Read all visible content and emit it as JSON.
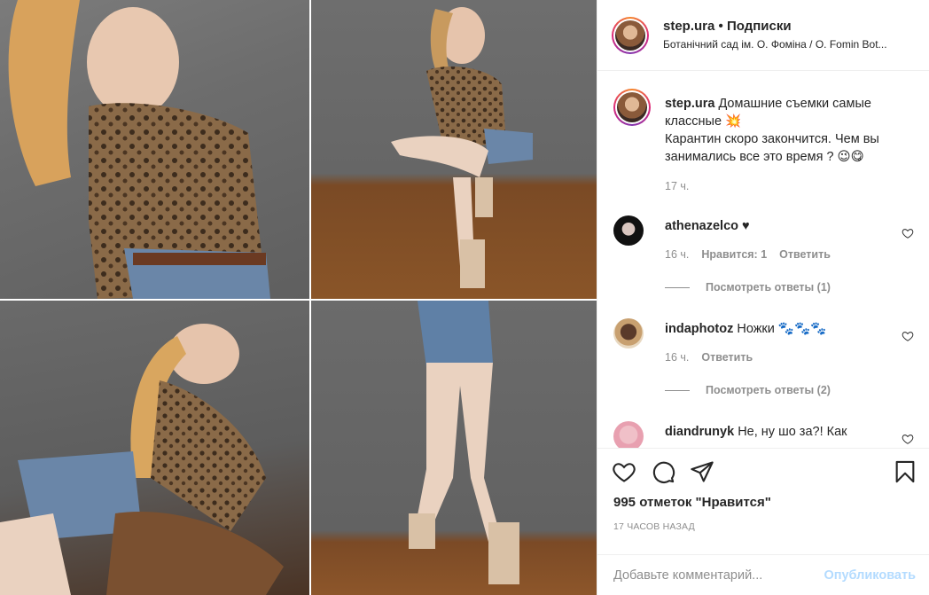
{
  "post": {
    "images": [
      "photo-collage"
    ]
  },
  "header": {
    "username": "step.ura",
    "separator": "•",
    "follow": "Подписки",
    "location": "Ботанічний сад ім. О. Фоміна / O. Fomin Bot..."
  },
  "caption": {
    "username": "step.ura",
    "text_line1": "Домашние съемки самые классные 💥",
    "text_line2": "Карантин скоро закончится. Чем вы занимались все это время ? 😉😋",
    "time": "17 ч."
  },
  "comments": [
    {
      "username": "athenazelco",
      "text": "♥",
      "time": "16 ч.",
      "likes": "Нравится: 1",
      "reply": "Ответить",
      "view_replies": "Посмотреть ответы (1)"
    },
    {
      "username": "indaphotoz",
      "text": "Ножки 🐾🐾🐾",
      "time": "16 ч.",
      "reply": "Ответить",
      "view_replies": "Посмотреть ответы (2)"
    },
    {
      "username": "diandrunyk",
      "text": "Не, ну шо за?! Как"
    }
  ],
  "actions": {
    "likes": "995 отметок \"Нравится\"",
    "time": "17 ЧАСОВ НАЗАД"
  },
  "add_comment": {
    "placeholder": "Добавьте комментарий...",
    "post_label": "Опубликовать"
  },
  "colors": {
    "text": "#262626",
    "muted": "#8e8e8e",
    "link_disabled": "#b3dbff",
    "border": "#efefef"
  }
}
